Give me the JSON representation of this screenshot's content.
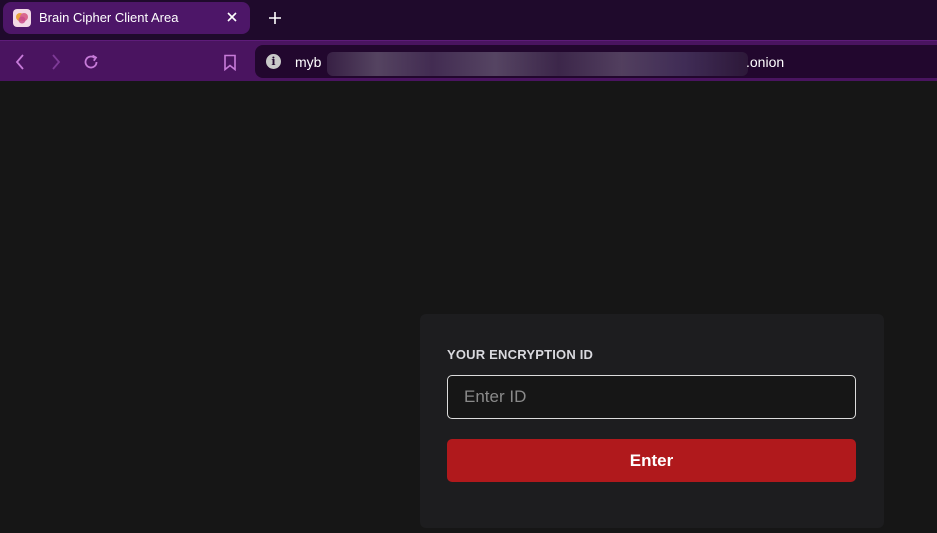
{
  "browser": {
    "tab": {
      "title": "Brain Cipher Client Area",
      "favicon": "brain-favicon-icon",
      "close_icon": "close-icon"
    },
    "new_tab_icon": "plus-icon",
    "toolbar": {
      "back_icon": "chevron-left-icon",
      "forward_icon": "chevron-right-icon",
      "reload_icon": "reload-icon",
      "bookmark_icon": "bookmark-icon",
      "site_info_icon": "info-icon"
    },
    "url": {
      "visible_prefix": "myb",
      "visible_suffix": ".onion",
      "redacted": true
    }
  },
  "login_card": {
    "label": "YOUR ENCRYPTION ID",
    "input_placeholder": "Enter ID",
    "input_value": "",
    "submit_label": "Enter"
  },
  "colors": {
    "tab_bar": "#1f0a2c",
    "active_tab": "#4d1668",
    "toolbar": "#4a1460",
    "page_background": "#161616",
    "card_background": "#1d1d1f",
    "button": "#b0191c",
    "nav_icon": "#c77bd9"
  }
}
